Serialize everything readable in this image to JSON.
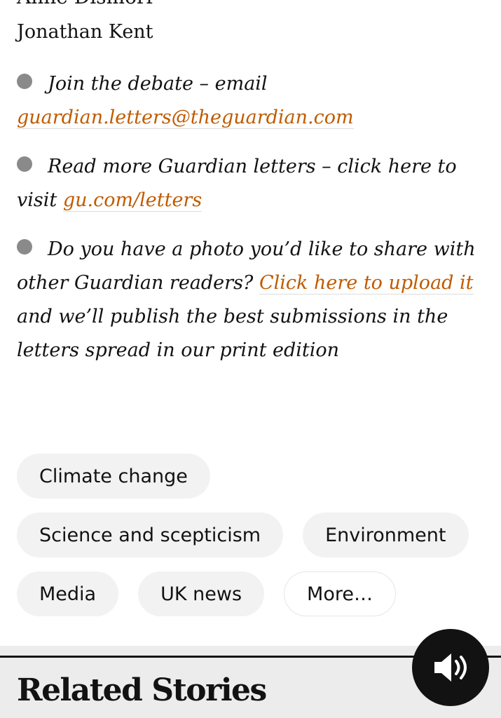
{
  "article": {
    "signatures": [
      "Anne Dismorr",
      "Jonathan Kent"
    ]
  },
  "footer_notes": [
    {
      "before": "Join the debate – email ",
      "link": "guardian.letters@theguardian.com",
      "after": ""
    },
    {
      "before": "Read more Guardian letters – click here to visit ",
      "link": "gu.com/letters",
      "after": ""
    },
    {
      "before": "Do you have a photo you’d like to share with other Guardian readers? ",
      "link": "Click here to upload it",
      "after": " and we’ll publish the best submissions in the letters spread in our print edition"
    }
  ],
  "tags": [
    "Climate change",
    "Science and scepticism",
    "Environment",
    "Media",
    "UK news",
    "More…"
  ],
  "related": {
    "title": "Related Stories"
  },
  "audio_button": {
    "icon": "speaker-icon",
    "background": "#121212"
  },
  "colors": {
    "link": "#c05b00",
    "bullet": "#8a8a8a",
    "tag_bg": "#f2f2f2",
    "related_bg": "#ececec"
  }
}
